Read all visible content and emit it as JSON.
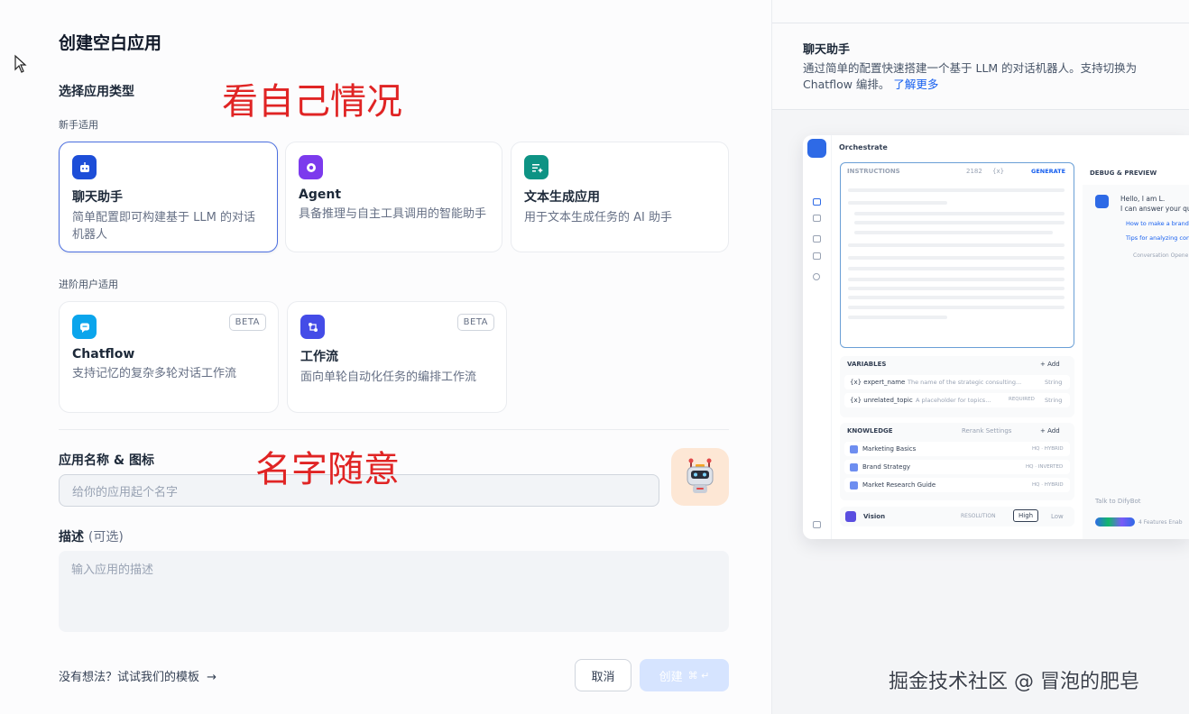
{
  "page": {
    "title": "创建空白应用"
  },
  "app_type": {
    "heading": "选择应用类型",
    "beginner_label": "新手适用",
    "advanced_label": "进阶用户适用",
    "beginner_cards": [
      {
        "title": "聊天助手",
        "desc": "简单配置即可构建基于 LLM 的对话机器人",
        "icon": "chat-bot-icon",
        "color": "#1d4ed8"
      },
      {
        "title": "Agent",
        "desc": "具备推理与自主工具调用的智能助手",
        "icon": "agent-icon",
        "color": "#7c3aed"
      },
      {
        "title": "文本生成应用",
        "desc": "用于文本生成任务的 AI 助手",
        "icon": "text-generate-icon",
        "color": "#0e9384"
      }
    ],
    "advanced_cards": [
      {
        "title": "Chatflow",
        "desc": "支持记忆的复杂多轮对话工作流",
        "badge": "BETA",
        "icon": "chatflow-icon",
        "color": "#0ba5ec"
      },
      {
        "title": "工作流",
        "desc": "面向单轮自动化任务的编排工作流",
        "badge": "BETA",
        "icon": "workflow-icon",
        "color": "#444ce7"
      }
    ]
  },
  "name_section": {
    "label": "应用名称 & 图标",
    "placeholder": "给你的应用起个名字"
  },
  "description": {
    "label": "描述",
    "optional": "(可选)",
    "placeholder": "输入应用的描述"
  },
  "footer": {
    "template_link": "没有想法？试试我们的模板",
    "cancel": "取消",
    "create": "创建",
    "create_shortcut": "⌘ ↵"
  },
  "annotations": {
    "type_note": "看自己情况",
    "name_note": "名字随意"
  },
  "watermark": "掘金技术社区 @ 冒泡的肥皂",
  "preview_panel": {
    "title": "聊天助手",
    "desc": "通过简单的配置快速搭建一个基于 LLM 的对话机器人。支持切换为 Chatflow 编排。",
    "learn_more": "了解更多",
    "mock": {
      "orchestrate": "Orchestrate",
      "instructions": "INSTRUCTIONS",
      "token_count": "2182",
      "var_tag": "{x}",
      "generate": "GENERATE",
      "debug": "DEBUG & PREVIEW",
      "greeting1": "Hello, I am L.",
      "greeting2": "I can answer your qu",
      "suggest1": "How to make a brand",
      "suggest2": "Tips for analyzing con",
      "opener": "Conversation Opene",
      "variables": "VARIABLES",
      "add": "+ Add",
      "var1_name": "{x} expert_name",
      "var1_desc": "The name of the strategic consulting...",
      "var1_type": "String",
      "var2_name": "{x} unrelated_topic",
      "var2_desc": "A placeholder for topics...",
      "required": "REQUIRED",
      "var2_type": "String",
      "knowledge": "KNOWLEDGE",
      "rerank": "Rerank Settings",
      "kb1": "Marketing Basics",
      "kb1_tag": "HQ · HYBRID",
      "kb2": "Brand Strategy",
      "kb2_tag": "HQ · INVERTED",
      "kb3": "Market Research Guide",
      "kb3_tag": "HQ · HYBRID",
      "vision": "Vision",
      "resolution": "RESOLUTION",
      "high": "High",
      "low": "Low",
      "talk": "Talk to DifyBot",
      "features": "4 Features Enab"
    }
  }
}
